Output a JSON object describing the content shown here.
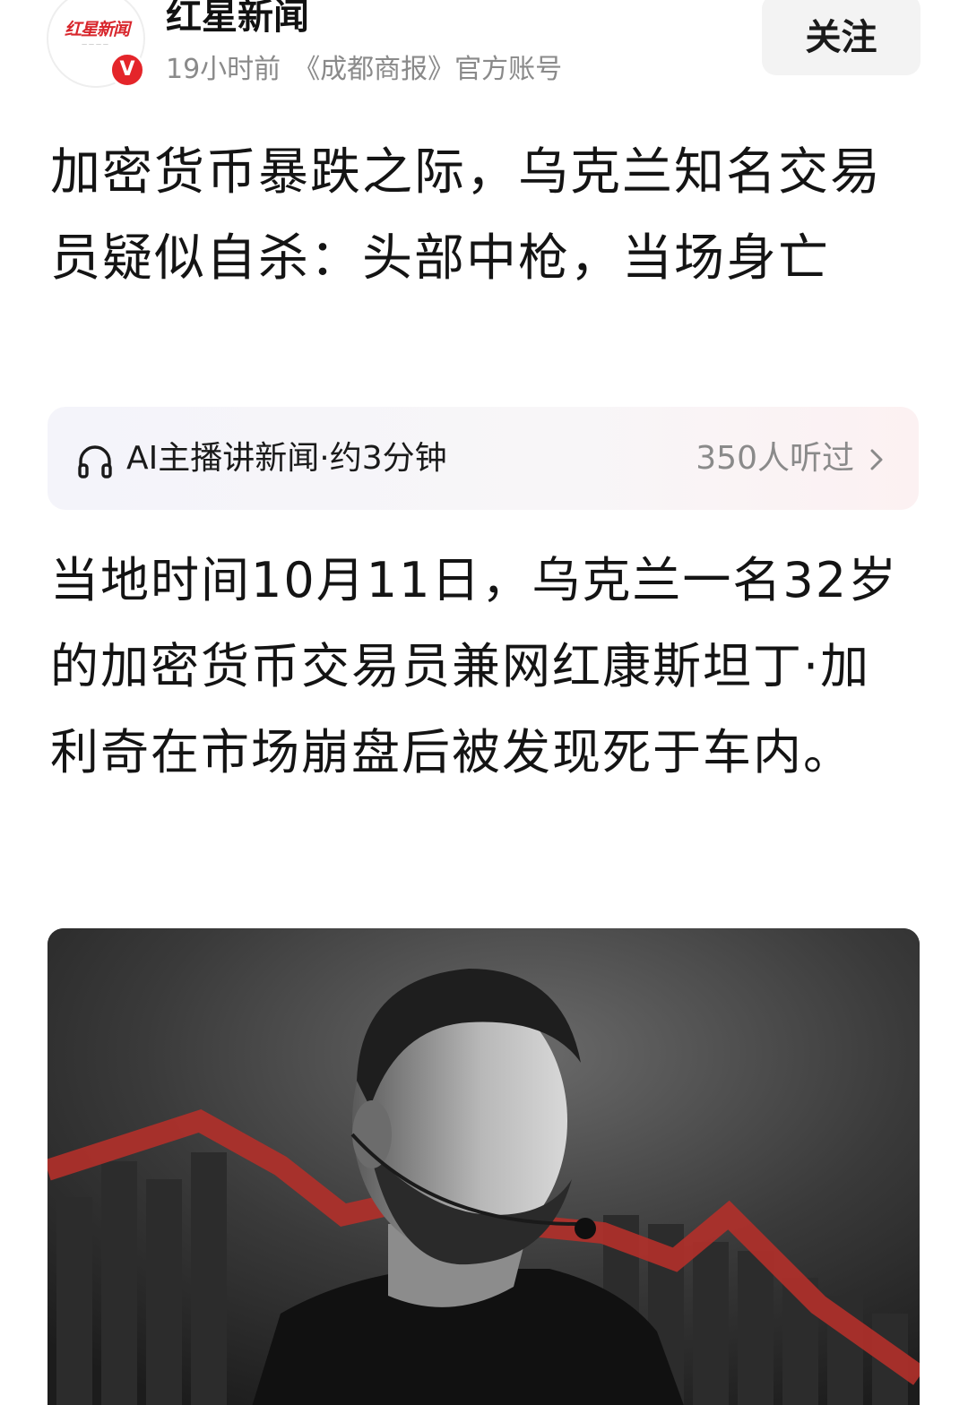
{
  "account": {
    "name": "红星新闻",
    "logo_text": "红星新闻",
    "verified_mark": "V",
    "time_ago": "19小时前",
    "source": "《成都商报》官方账号",
    "follow_label": "关注"
  },
  "article": {
    "title": "加密货币暴跌之际，乌克兰知名交易员疑似自杀：头部中枪，当场身亡",
    "body": "当地时间10月11日，乌克兰一名32岁的加密货币交易员兼网红康斯坦丁·加利奇在市场崩盘后被发现死于车内。"
  },
  "audio": {
    "label": "AI主播讲新闻·约3分钟",
    "listeners": "350人听过",
    "icon": "headphone-icon"
  },
  "image": {
    "description_icon": "photo",
    "accent_color": "#c9302c"
  },
  "colors": {
    "brand_red": "#e4252a",
    "text": "#141414",
    "muted": "#8a8a8a"
  }
}
